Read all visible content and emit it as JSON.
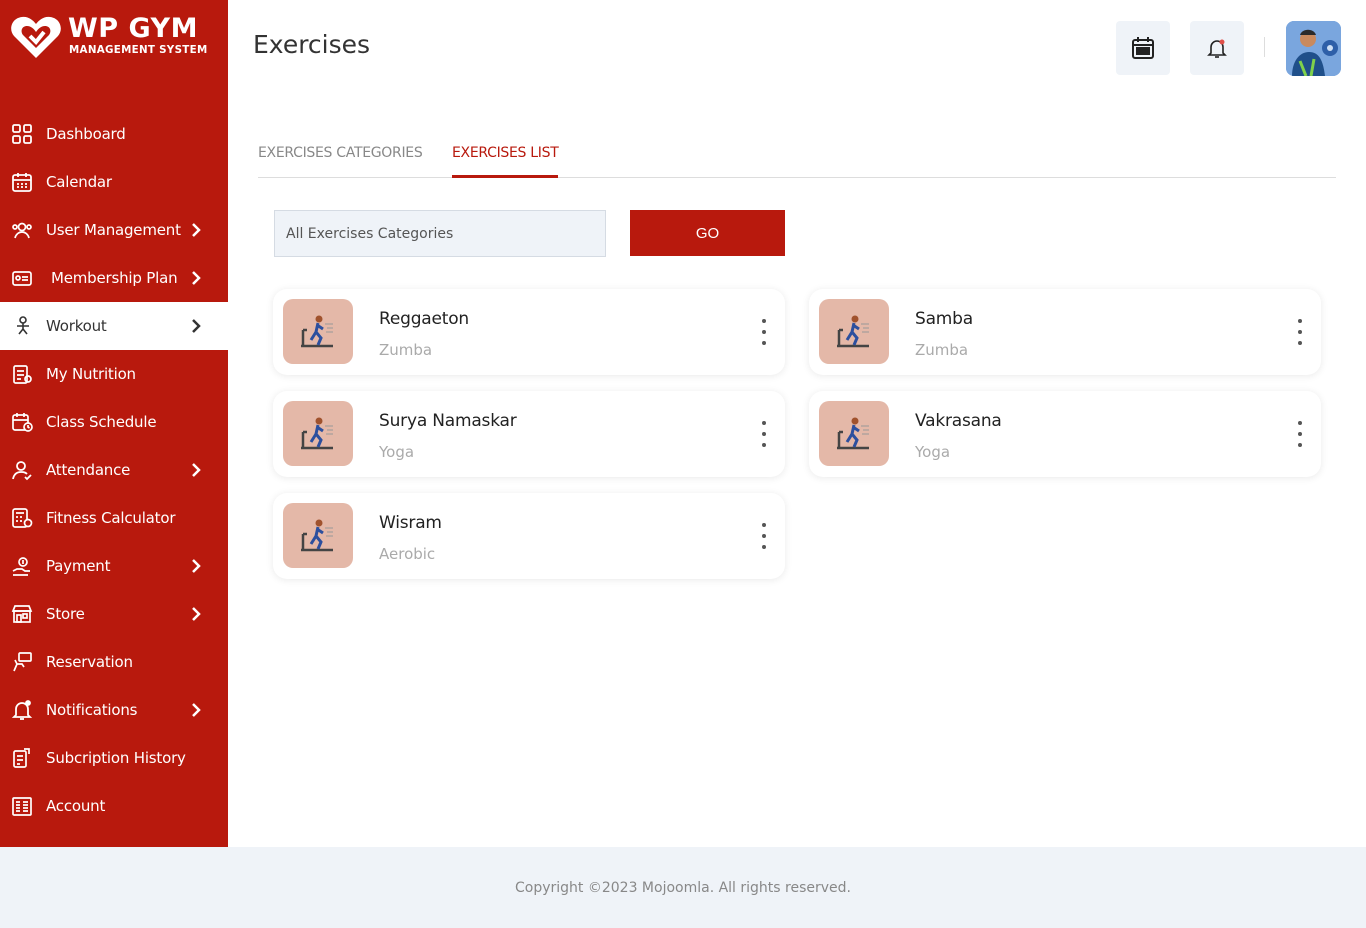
{
  "brand": {
    "title": "WP GYM",
    "subtitle": "MANAGEMENT SYSTEM",
    "accent_color": "#b8190d"
  },
  "sidebar": {
    "items": [
      {
        "label": "Dashboard",
        "icon": "dashboard-grid-icon",
        "has_submenu": false,
        "active": false
      },
      {
        "label": "Calendar",
        "icon": "calendar-icon",
        "has_submenu": false,
        "active": false
      },
      {
        "label": "User Management",
        "icon": "users-gear-icon",
        "has_submenu": true,
        "active": false
      },
      {
        "label": "Membership Plan",
        "icon": "membership-card-icon",
        "has_submenu": true,
        "active": false
      },
      {
        "label": "Workout",
        "icon": "workout-icon",
        "has_submenu": true,
        "active": true
      },
      {
        "label": "My Nutrition",
        "icon": "nutrition-icon",
        "has_submenu": false,
        "active": false
      },
      {
        "label": "Class Schedule",
        "icon": "class-schedule-icon",
        "has_submenu": false,
        "active": false
      },
      {
        "label": "Attendance",
        "icon": "attendance-icon",
        "has_submenu": true,
        "active": false
      },
      {
        "label": "Fitness Calculator",
        "icon": "calculator-icon",
        "has_submenu": false,
        "active": false
      },
      {
        "label": "Payment",
        "icon": "payment-icon",
        "has_submenu": true,
        "active": false
      },
      {
        "label": "Store",
        "icon": "store-icon",
        "has_submenu": true,
        "active": false
      },
      {
        "label": "Reservation",
        "icon": "reservation-icon",
        "has_submenu": false,
        "active": false
      },
      {
        "label": "Notifications",
        "icon": "bell-icon",
        "has_submenu": true,
        "active": false
      },
      {
        "label": "Subcription History",
        "icon": "subscription-history-icon",
        "has_submenu": false,
        "active": false
      },
      {
        "label": "Account",
        "icon": "account-icon",
        "has_submenu": false,
        "active": false
      }
    ]
  },
  "header": {
    "title": "Exercises",
    "calendar_button_icon": "calendar-icon",
    "notification_button_icon": "bell-icon",
    "avatar_icon": "user-avatar"
  },
  "tabs": [
    {
      "label": "EXERCISES CATEGORIES",
      "active": false
    },
    {
      "label": "EXERCISES LIST",
      "active": true
    }
  ],
  "filter": {
    "selected": "All Exercises Categories",
    "go_label": "GO"
  },
  "exercises": [
    {
      "name": "Reggaeton",
      "category": "Zumba"
    },
    {
      "name": "Samba",
      "category": "Zumba"
    },
    {
      "name": "Surya Namaskar",
      "category": "Yoga"
    },
    {
      "name": "Vakrasana",
      "category": "Yoga"
    },
    {
      "name": "Wisram",
      "category": "Aerobic"
    }
  ],
  "footer": {
    "copyright": "Copyright ©2023 Mojoomla. All rights reserved."
  }
}
